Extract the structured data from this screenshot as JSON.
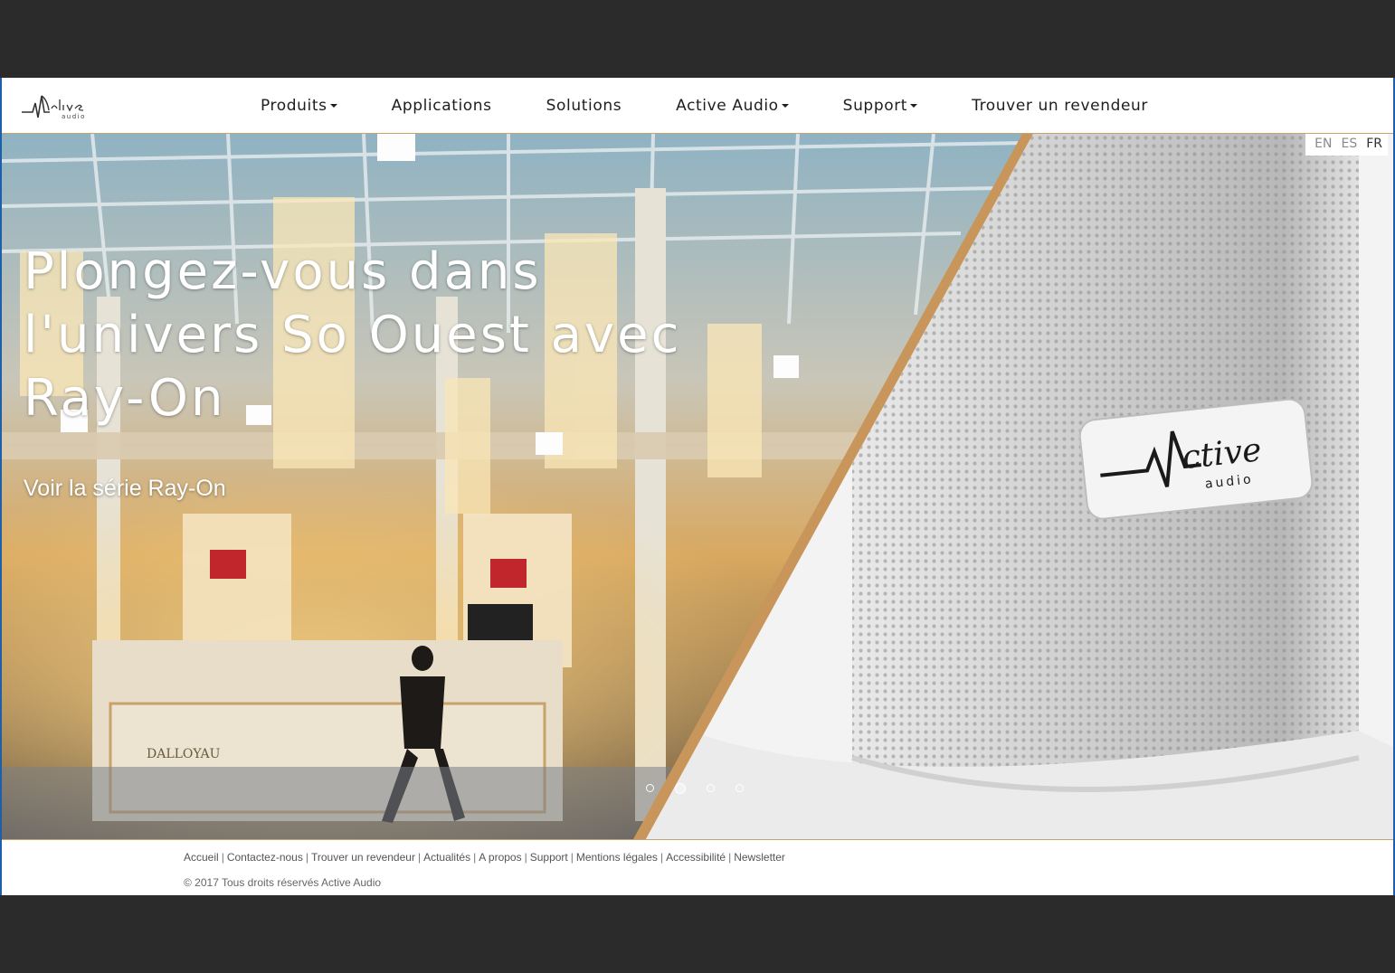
{
  "nav": {
    "items": [
      {
        "label": "Produits",
        "dropdown": true
      },
      {
        "label": "Applications",
        "dropdown": false
      },
      {
        "label": "Solutions",
        "dropdown": false
      },
      {
        "label": "Active Audio",
        "dropdown": true
      },
      {
        "label": "Support",
        "dropdown": true
      },
      {
        "label": "Trouver un revendeur",
        "dropdown": false
      }
    ]
  },
  "brand": {
    "logo": "Active audio",
    "accent": "#c9a26b"
  },
  "lang": {
    "options": [
      "EN",
      "ES",
      "FR"
    ],
    "selected": "FR"
  },
  "hero": {
    "headline_lines": [
      "Plongez-vous dans",
      "l'univers So Ouest avec",
      "Ray-On"
    ],
    "cta": "Voir la série Ray-On",
    "slides_count": 4,
    "active_slide": 2
  },
  "footer": {
    "links": [
      "Accueil",
      "Contactez-nous",
      "Trouver un revendeur",
      "Actualités",
      "A propos",
      "Support",
      "Mentions légales",
      "Accessibilité",
      "Newsletter"
    ],
    "copyright": "© 2017 Tous droits réservés Active Audio"
  }
}
